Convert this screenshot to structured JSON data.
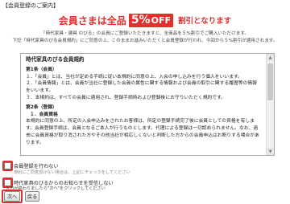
{
  "section_title": "【会員登録のご案内】",
  "banner": {
    "prefix": "会員さまは全品",
    "percent": "5%",
    "off": "OFF",
    "suffix": "割引となります"
  },
  "intro": {
    "line1": "「時代家具・建具 のびる」の会員にご登録いただきますと、全商品を５%割引でご購入いただけます。",
    "line2": "下記「時代家具のびる会員規約」にご同意の上、このままお進みいただくと会員登録が行われ、今回から５%割引が適用されます。"
  },
  "terms": {
    "title": "時代家具のびる会員規約",
    "article1_heading": "第1条（会員）",
    "article1_p1": "１．「会員」とは、当社が定める手続に従い本規約に同意の上、入会の申し込みを行う個人をいいます。",
    "article1_p2": "２．「会員情報」とは、会員が当社に登録した会員の属性に関する情報および会員の取引に関する履歴等の情報をいいます。",
    "article1_p3": "３．本規約は、すべての会員に適用され、登録手続時および登録後にお守りいただく規約です。",
    "article2_heading": "第2条（登録）",
    "article2_sub1": "１．会員資格",
    "article2_p1": "本規約に同意の上、所定の入会申込みをされたお客様は、所定の登録手続完了後に会員としての資格を有します。会員登録手続は、会員となるご本人が行うものとします。代理による登録は一切認められません。なお、過去に会員資格が取り消された方やその他当社が相応しくないと判断した方からの会員申込はお断りする場合があります。"
  },
  "options": {
    "no_register_label": "会員登録を行わない",
    "no_register_note": "規約にご同意頂けない場合は、上記にチェックをしてください",
    "no_mail_label": "時代家具のびるからのお知らせを受信しない",
    "continue_note": "入力が終わりましたら\"次へ\"をクリックしてください"
  },
  "buttons": {
    "next": "次へ",
    "back": "戻る"
  },
  "colors": {
    "accent": "#e0302f"
  }
}
